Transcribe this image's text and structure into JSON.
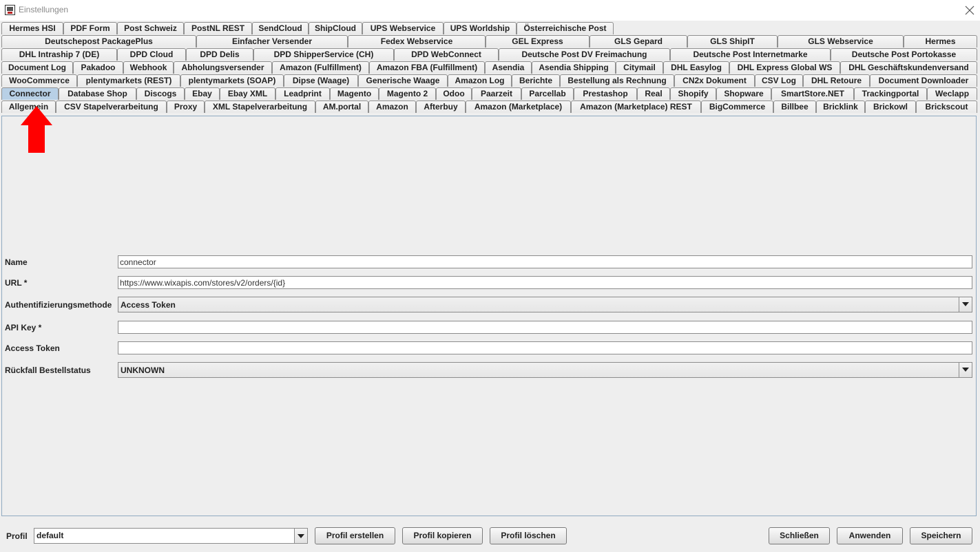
{
  "window": {
    "title": "Einstellungen"
  },
  "tabs": {
    "row1": [
      "Hermes HSI",
      "PDF Form",
      "Post Schweiz",
      "PostNL REST",
      "SendCloud",
      "ShipCloud",
      "UPS Webservice",
      "UPS Worldship",
      "Österreichische Post"
    ],
    "row2": [
      "Deutschepost PackagePlus",
      "Einfacher Versender",
      "Fedex Webservice",
      "GEL Express",
      "GLS Gepard",
      "GLS ShipIT",
      "GLS Webservice",
      "Hermes"
    ],
    "row3": [
      "DHL Intraship 7 (DE)",
      "DPD Cloud",
      "DPD Delis",
      "DPD ShipperService (CH)",
      "DPD WebConnect",
      "Deutsche Post DV Freimachung",
      "Deutsche Post Internetmarke",
      "Deutsche Post Portokasse"
    ],
    "row4": [
      "Document Log",
      "Pakadoo",
      "Webhook",
      "Abholungsversender",
      "Amazon (Fulfillment)",
      "Amazon FBA (Fulfillment)",
      "Asendia",
      "Asendia Shipping",
      "Citymail",
      "DHL Easylog",
      "DHL Express Global WS",
      "DHL Geschäftskundenversand"
    ],
    "row5": [
      "WooCommerce",
      "plentymarkets (REST)",
      "plentymarkets (SOAP)",
      "Dipse (Waage)",
      "Generische Waage",
      "Amazon Log",
      "Berichte",
      "Bestellung als Rechnung",
      "CN2x Dokument",
      "CSV Log",
      "DHL Retoure",
      "Document Downloader"
    ],
    "row6": [
      "Connector",
      "Database Shop",
      "Discogs",
      "Ebay",
      "Ebay XML",
      "Leadprint",
      "Magento",
      "Magento 2",
      "Odoo",
      "Paarzeit",
      "Parcellab",
      "Prestashop",
      "Real",
      "Shopify",
      "Shopware",
      "SmartStore.NET",
      "Trackingportal",
      "Weclapp"
    ],
    "row7": [
      "Allgemein",
      "CSV Stapelverarbeitung",
      "Proxy",
      "XML Stapelverarbeitung",
      "AM.portal",
      "Amazon",
      "Afterbuy",
      "Amazon (Marketplace)",
      "Amazon (Marketplace) REST",
      "BigCommerce",
      "Billbee",
      "Bricklink",
      "Brickowl",
      "Brickscout"
    ],
    "selected": "Connector"
  },
  "form": {
    "name_label": "Name",
    "name_value": "connector",
    "url_label": "URL *",
    "url_value": "https://www.wixapis.com/stores/v2/orders/{id}",
    "auth_label": "Authentifizierungsmethode",
    "auth_value": "Access Token",
    "apikey_label": "API Key *",
    "apikey_value": "",
    "token_label": "Access Token",
    "token_value": "",
    "fallback_label": "Rückfall Bestellstatus",
    "fallback_value": "UNKNOWN"
  },
  "bottom": {
    "profil_label": "Profil",
    "profil_value": "default",
    "create_label": "Profil erstellen",
    "copy_label": "Profil kopieren",
    "delete_label": "Profil löschen",
    "close_label": "Schließen",
    "apply_label": "Anwenden",
    "save_label": "Speichern"
  },
  "colors": {
    "selected_tab": "#b8d0e6",
    "arrow": "#ff0000"
  },
  "icons": {
    "app": "app-icon",
    "close": "close-icon",
    "dropdown": "chevron-down-icon"
  }
}
